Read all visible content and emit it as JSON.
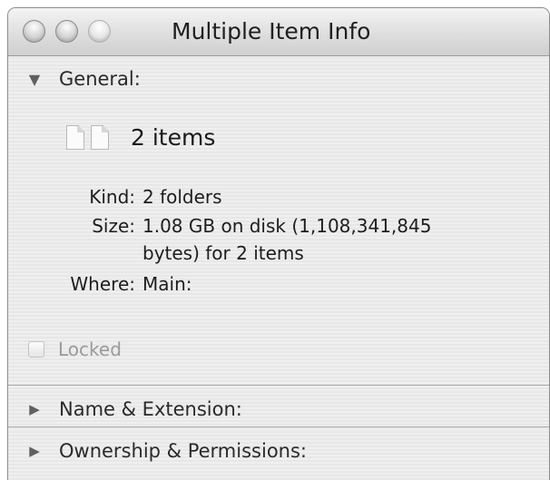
{
  "window": {
    "title": "Multiple Item Info"
  },
  "general": {
    "header_label": "General:",
    "items_count": "2 items",
    "kind": {
      "label": "Kind:",
      "value": "2 folders"
    },
    "size": {
      "label": "Size:",
      "value_line1": "1.08 GB on disk (1,108,341,845",
      "value_line2": "bytes) for 2 items"
    },
    "where": {
      "label": "Where:",
      "value": "Main:"
    },
    "locked_label": "Locked",
    "locked_checked": false,
    "locked_enabled": false
  },
  "sections": {
    "name_extension": "Name & Extension:",
    "ownership_permissions": "Ownership & Permissions:"
  },
  "icons": {
    "general_disclosure": "triangle-down-icon",
    "collapsed_disclosure": "triangle-right-icon",
    "item_icon": "document-icon"
  }
}
